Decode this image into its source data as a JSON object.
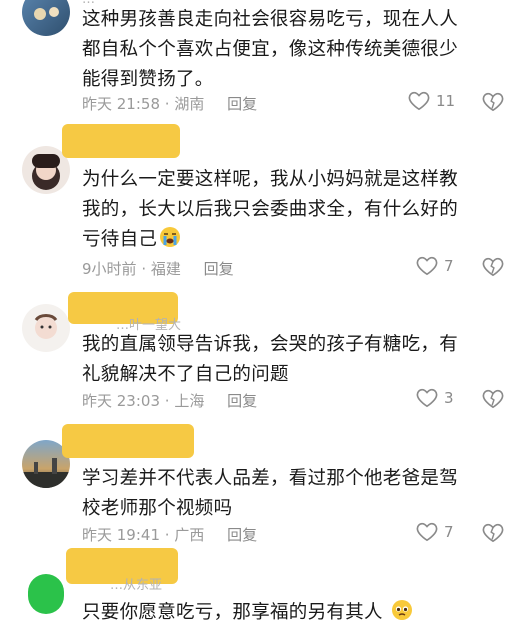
{
  "comments": [
    {
      "text_lines": [
        "这种男孩善良走向社会很容易吃亏，现在人人",
        "都自私个个喜欢占便宜，像这种传统美德很少",
        "能得到赞扬了。"
      ],
      "time": "昨天 21:58",
      "location": "湖南",
      "reply_label": "回复",
      "likes": "11"
    },
    {
      "text_lines": [
        "为什么一定要这样呢，我从小妈妈就是这样教",
        "我的，长大以后我只会委曲求全，有什么好的",
        "亏待自己"
      ],
      "emoji": "loudly-crying-face",
      "time": "9小时前",
      "location": "福建",
      "reply_label": "回复",
      "likes": "7"
    },
    {
      "name_partial": "…叶一望大",
      "text_lines": [
        "我的直属领导告诉我，会哭的孩子有糖吃，有",
        "礼貌解决不了自己的问题"
      ],
      "time": "昨天 23:03",
      "location": "上海",
      "reply_label": "回复",
      "likes": "3"
    },
    {
      "text_lines": [
        "学习差并不代表人品差，看过那个他老爸是驾",
        "校老师那个视频吗"
      ],
      "time": "昨天 19:41",
      "location": "广西",
      "reply_label": "回复",
      "likes": "7"
    },
    {
      "name_partial": "…从东亚",
      "text_lines": [
        "只要你愿意吃亏，那享福的另有其人"
      ],
      "emoji": "pleading-face"
    }
  ],
  "colors": {
    "highlight": "#f6c944",
    "meta_text": "#9a9a9a",
    "icon_stroke": "#8a8a8a"
  }
}
